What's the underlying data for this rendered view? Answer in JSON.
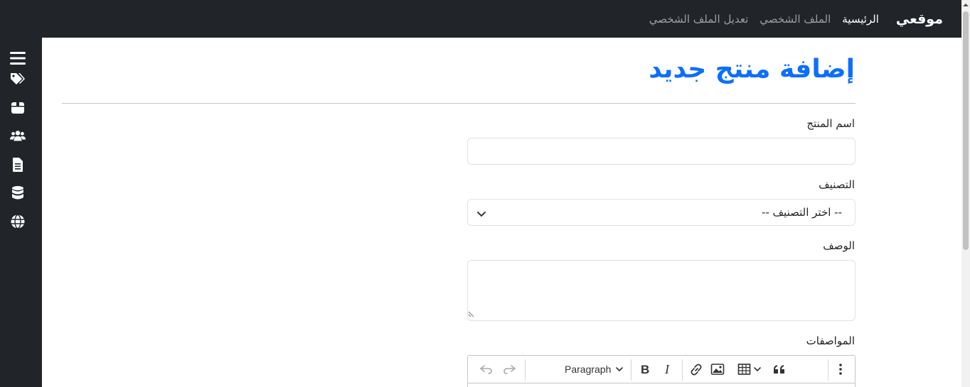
{
  "navbar": {
    "brand": "موقعي",
    "links": [
      {
        "label": "الرئيسية",
        "active": true
      },
      {
        "label": "الملف الشخصي",
        "active": false
      },
      {
        "label": "تعديل الملف الشخصي",
        "active": false
      }
    ]
  },
  "sidebar": {
    "icons": [
      "menu-icon",
      "tags-icon",
      "box-icon",
      "users-icon",
      "file-icon",
      "database-icon",
      "globe-icon"
    ]
  },
  "main": {
    "title": "إضافة منتج جديد",
    "form": {
      "name_label": "اسم المنتج",
      "name_value": "",
      "category_label": "التصنيف",
      "category_selected": "-- اختر التصنيف --",
      "description_label": "الوصف",
      "description_value": "",
      "specs_label": "المواصفات",
      "editor": {
        "paragraph_label": "Paragraph",
        "tools": [
          "undo-icon",
          "redo-icon",
          "bold-icon",
          "italic-icon",
          "link-icon",
          "image-icon",
          "table-icon",
          "quote-icon",
          "more-icon"
        ]
      }
    }
  },
  "colors": {
    "navbar_bg": "#212529",
    "title": "#0d6efd"
  }
}
